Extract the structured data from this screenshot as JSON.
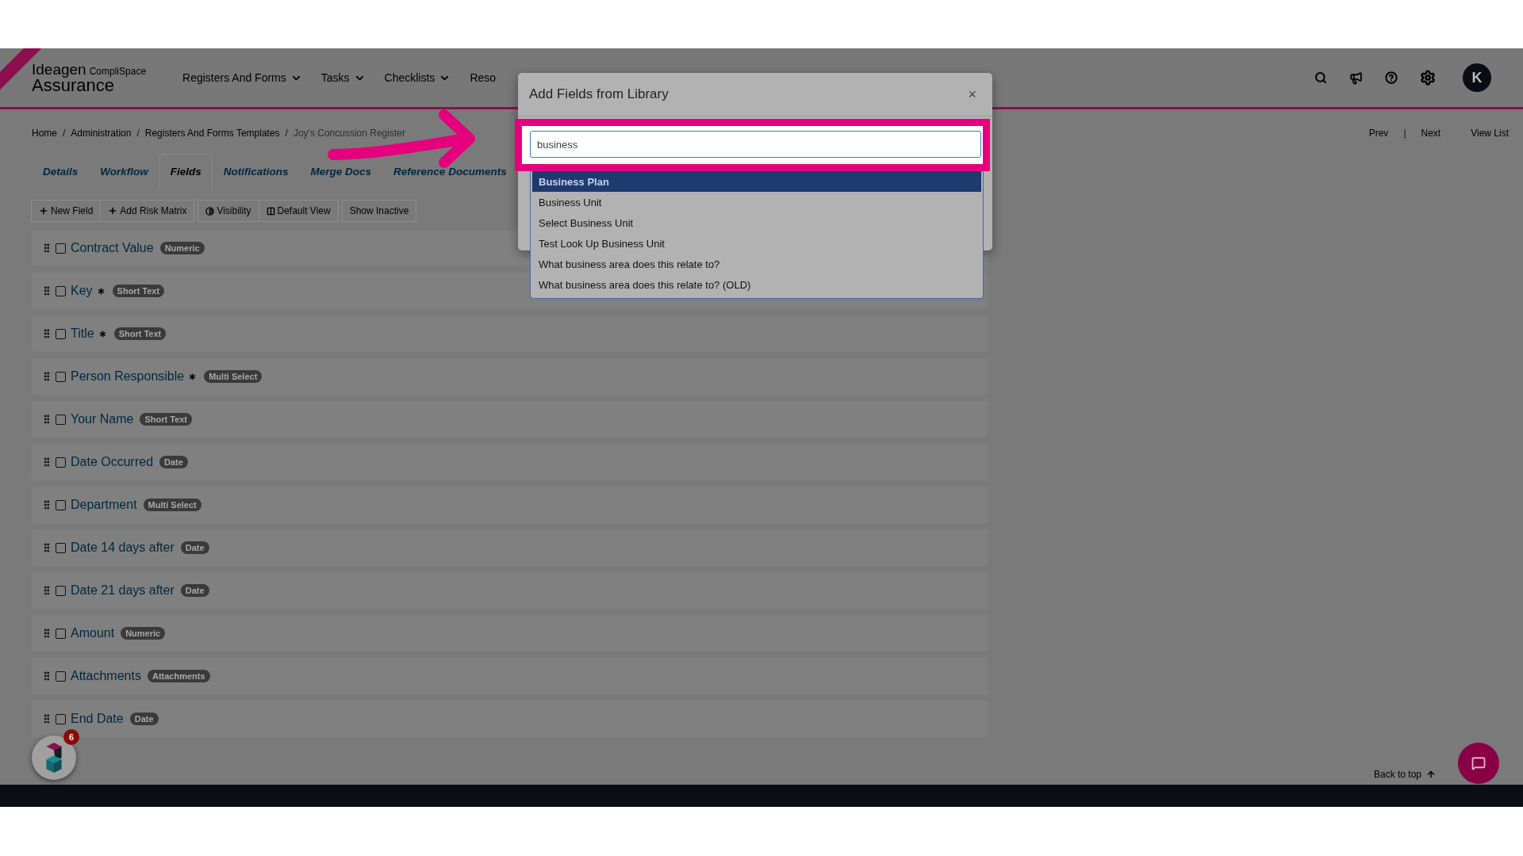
{
  "header": {
    "logo": {
      "brand": "Ideagen",
      "product": "CompliSpace",
      "name": "Assurance"
    },
    "nav": [
      {
        "label": "Registers And Forms",
        "caret": true
      },
      {
        "label": "Tasks",
        "caret": true
      },
      {
        "label": "Checklists",
        "caret": true
      },
      {
        "label": "Reso",
        "caret": false
      }
    ],
    "avatar": "K"
  },
  "breadcrumb": [
    "Home",
    "Administration",
    "Registers And Forms Templates",
    "Joy's Concussion Register"
  ],
  "breadcrumb_separator": "/",
  "pager": [
    "Prev",
    "Next",
    "View List"
  ],
  "pager_separator": "|",
  "tabs": [
    {
      "label": "Details",
      "selected": false
    },
    {
      "label": "Workflow",
      "selected": false
    },
    {
      "label": "Fields",
      "selected": true
    },
    {
      "label": "Notifications",
      "selected": false
    },
    {
      "label": "Merge Docs",
      "selected": false
    },
    {
      "label": "Reference Documents",
      "selected": false
    }
  ],
  "toolbar": [
    [
      {
        "label": "New Field",
        "kind": "plus"
      },
      {
        "label": "Add Risk Matrix",
        "kind": "plus"
      }
    ],
    [
      {
        "label": "Visibility",
        "kind": "contrast"
      },
      {
        "label": "Default View",
        "kind": "columns"
      }
    ],
    [
      {
        "label": "Show Inactive",
        "kind": "plain"
      }
    ]
  ],
  "fields": [
    {
      "name": "Contract Value",
      "required": false,
      "type": "Numeric",
      "checked": false
    },
    {
      "name": "Key",
      "required": true,
      "type": "Short Text",
      "checked": false
    },
    {
      "name": "Title",
      "required": true,
      "type": "Short Text",
      "checked": false
    },
    {
      "name": "Person Responsible",
      "required": true,
      "type": "Multi Select",
      "checked": false
    },
    {
      "name": "Your Name",
      "required": false,
      "type": "Short Text",
      "checked": false
    },
    {
      "name": "Date Occurred",
      "required": false,
      "type": "Date",
      "checked": false
    },
    {
      "name": "Department",
      "required": false,
      "type": "Multi Select",
      "checked": false
    },
    {
      "name": "Date 14 days after",
      "required": false,
      "type": "Date",
      "checked": false
    },
    {
      "name": "Date 21 days after",
      "required": false,
      "type": "Date",
      "checked": false
    },
    {
      "name": "Amount",
      "required": false,
      "type": "Numeric",
      "checked": false
    },
    {
      "name": "Attachments",
      "required": false,
      "type": "Attachments",
      "checked": false
    },
    {
      "name": "End Date",
      "required": false,
      "type": "Date",
      "checked": false
    }
  ],
  "back_to_top": "Back to top",
  "widget_badge": "6",
  "modal": {
    "title": "Add Fields from Library",
    "close": "×",
    "search": {
      "value": "business"
    },
    "results": [
      {
        "label": "Business Plan",
        "selected": true
      },
      {
        "label": "Business Unit",
        "selected": false
      },
      {
        "label": "Select Business Unit",
        "selected": false
      },
      {
        "label": "Test Look Up Business Unit",
        "selected": false
      },
      {
        "label": "What business area does this relate to?",
        "selected": false
      },
      {
        "label": "What business area does this relate to? (OLD)",
        "selected": false
      }
    ]
  }
}
